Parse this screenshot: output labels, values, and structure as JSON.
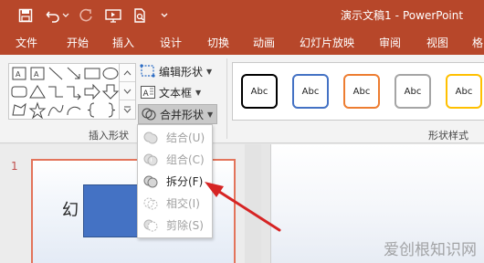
{
  "app": {
    "doc_name": "演示文稿1",
    "separator": "-",
    "app_name": "PowerPoint",
    "accent": "#b7472a"
  },
  "tabs": [
    "文件",
    "开始",
    "插入",
    "设计",
    "切换",
    "动画",
    "幻灯片放映",
    "审阅",
    "视图",
    "格"
  ],
  "ribbon": {
    "edit_shape": "编辑形状",
    "text_box": "文本框",
    "merge_shapes": "合并形状",
    "insert_shapes_label": "插入形状",
    "shape_styles_label": "形状样式",
    "style_samples": [
      {
        "text": "Abc",
        "color": "#000000"
      },
      {
        "text": "Abc",
        "color": "#4472c4"
      },
      {
        "text": "Abc",
        "color": "#ed7d31"
      },
      {
        "text": "Abc",
        "color": "#a5a5a5"
      },
      {
        "text": "Abc",
        "color": "#ffc000"
      }
    ]
  },
  "merge_menu": {
    "items": [
      {
        "label": "结合(U)",
        "icon": "union-icon",
        "enabled": false
      },
      {
        "label": "组合(C)",
        "icon": "combine-icon",
        "enabled": false
      },
      {
        "label": "拆分(F)",
        "icon": "fragment-icon",
        "enabled": true
      },
      {
        "label": "相交(I)",
        "icon": "intersect-icon",
        "enabled": false
      },
      {
        "label": "剪除(S)",
        "icon": "subtract-icon",
        "enabled": false
      }
    ]
  },
  "slides": {
    "number": "1",
    "thumb_text": "幻"
  },
  "watermark": "爱创根知识网"
}
